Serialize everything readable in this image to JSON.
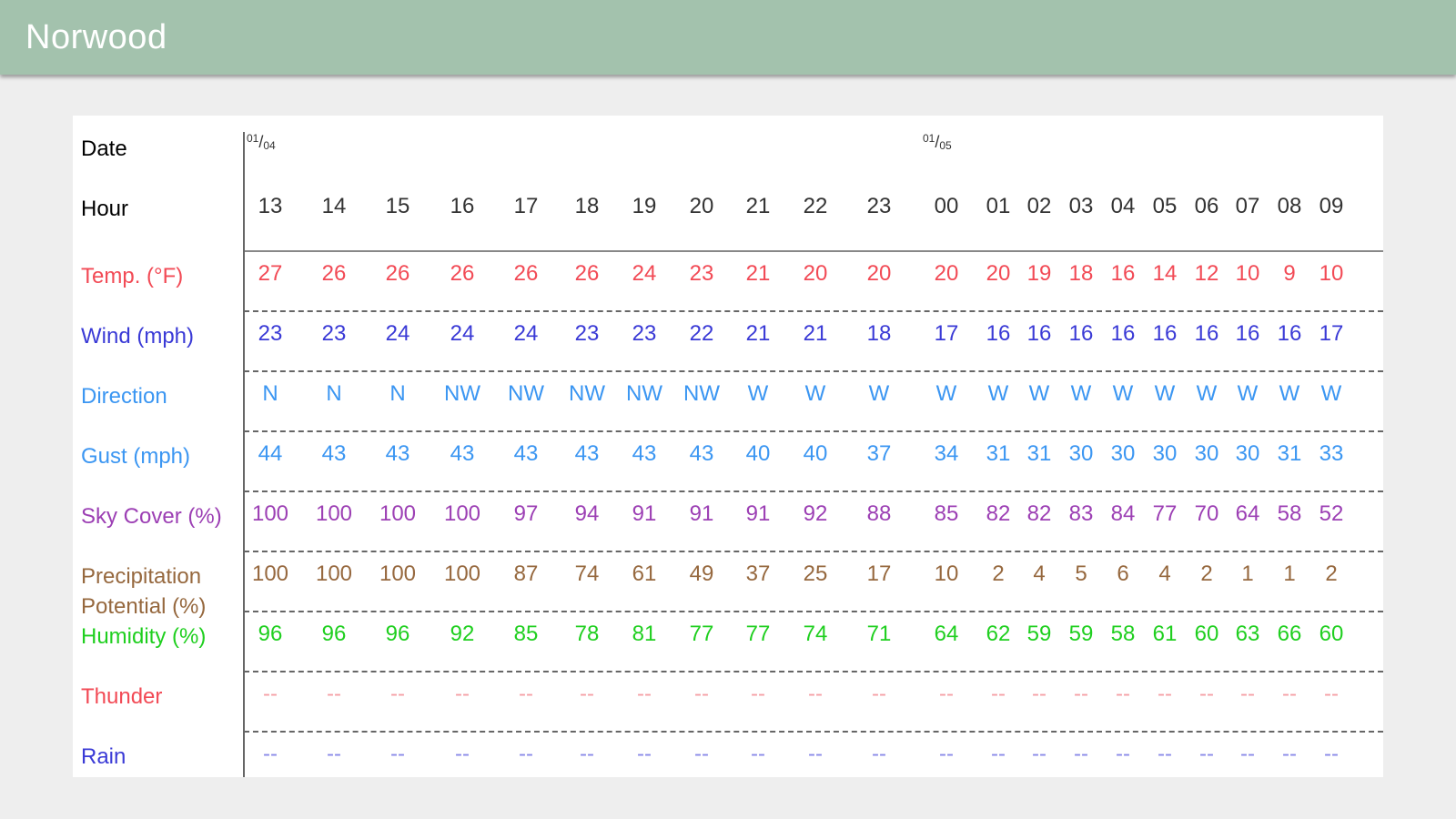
{
  "app": {
    "title": "Norwood"
  },
  "colors": {
    "appbar": "#a3c2ad",
    "temp": "#f24a55",
    "wind": "#3a3ad6",
    "direction": "#3b96f2",
    "gust": "#3b96f2",
    "sky": "#9c3fb4",
    "precip": "#96683e",
    "humidity": "#1fcf1f",
    "thunder": "#f24a55",
    "rain": "#3a3ad6"
  },
  "dates": [
    {
      "month": "01",
      "day": "04",
      "at_hour_index": 0
    },
    {
      "month": "01",
      "day": "05",
      "at_hour_index": 11
    }
  ],
  "labels": {
    "date": "Date",
    "hour": "Hour",
    "temp": "Temp. (°F)",
    "wind": "Wind (mph)",
    "direction": "Direction",
    "gust": "Gust (mph)",
    "sky": "Sky Cover (%)",
    "precip": "Precipitation\nPotential (%)",
    "humidity": "Humidity (%)",
    "thunder": "Thunder",
    "rain": "Rain"
  },
  "hours": [
    "13",
    "14",
    "15",
    "16",
    "17",
    "18",
    "19",
    "20",
    "21",
    "22",
    "23",
    "00",
    "01",
    "02",
    "03",
    "04",
    "05",
    "06",
    "07",
    "08",
    "09"
  ],
  "temp": [
    "27",
    "26",
    "26",
    "26",
    "26",
    "26",
    "24",
    "23",
    "21",
    "20",
    "20",
    "20",
    "20",
    "19",
    "18",
    "16",
    "14",
    "12",
    "10",
    "9",
    "10"
  ],
  "wind": [
    "23",
    "23",
    "24",
    "24",
    "24",
    "23",
    "23",
    "22",
    "21",
    "21",
    "18",
    "17",
    "16",
    "16",
    "16",
    "16",
    "16",
    "16",
    "16",
    "16",
    "17"
  ],
  "direction": [
    "N",
    "N",
    "N",
    "NW",
    "NW",
    "NW",
    "NW",
    "NW",
    "W",
    "W",
    "W",
    "W",
    "W",
    "W",
    "W",
    "W",
    "W",
    "W",
    "W",
    "W",
    "W"
  ],
  "gust": [
    "44",
    "43",
    "43",
    "43",
    "43",
    "43",
    "43",
    "43",
    "40",
    "40",
    "37",
    "34",
    "31",
    "31",
    "30",
    "30",
    "30",
    "30",
    "30",
    "31",
    "33"
  ],
  "sky": [
    "100",
    "100",
    "100",
    "100",
    "97",
    "94",
    "91",
    "91",
    "91",
    "92",
    "88",
    "85",
    "82",
    "82",
    "83",
    "84",
    "77",
    "70",
    "64",
    "58",
    "52"
  ],
  "precip": [
    "100",
    "100",
    "100",
    "100",
    "87",
    "74",
    "61",
    "49",
    "37",
    "25",
    "17",
    "10",
    "2",
    "4",
    "5",
    "6",
    "4",
    "2",
    "1",
    "1",
    "2"
  ],
  "humidity": [
    "96",
    "96",
    "96",
    "92",
    "85",
    "78",
    "81",
    "77",
    "77",
    "74",
    "71",
    "64",
    "62",
    "59",
    "59",
    "58",
    "61",
    "60",
    "63",
    "66",
    "60"
  ],
  "thunder": [
    "--",
    "--",
    "--",
    "--",
    "--",
    "--",
    "--",
    "--",
    "--",
    "--",
    "--",
    "--",
    "--",
    "--",
    "--",
    "--",
    "--",
    "--",
    "--",
    "--",
    "--"
  ],
  "rain": [
    "--",
    "--",
    "--",
    "--",
    "--",
    "--",
    "--",
    "--",
    "--",
    "--",
    "--",
    "--",
    "--",
    "--",
    "--",
    "--",
    "--",
    "--",
    "--",
    "--",
    "--"
  ]
}
